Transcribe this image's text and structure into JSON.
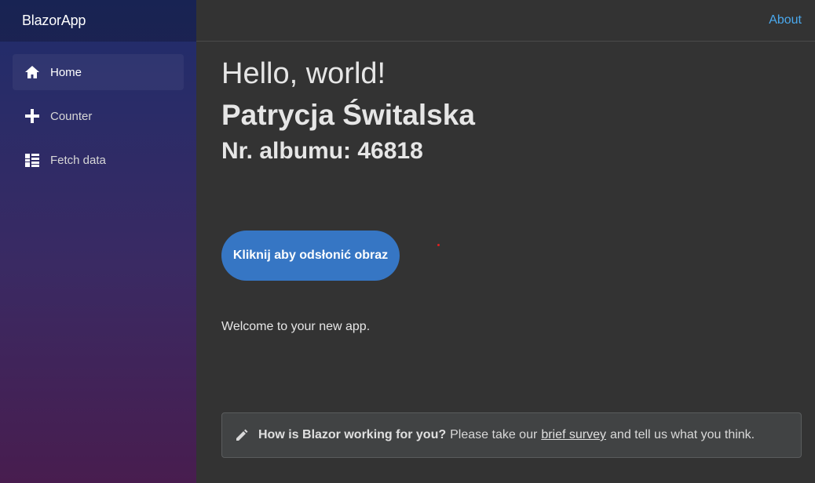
{
  "brand": "BlazorApp",
  "top_row": {
    "about": "About"
  },
  "nav": [
    {
      "label": "Home",
      "icon": "home-icon"
    },
    {
      "label": "Counter",
      "icon": "plus-icon"
    },
    {
      "label": "Fetch data",
      "icon": "list-icon"
    }
  ],
  "main": {
    "hello": "Hello, world!",
    "name": "Patrycja Świtalska",
    "album": "Nr. albumu: 46818",
    "button": "Kliknij aby odsłonić obraz",
    "welcome": "Welcome to your new app."
  },
  "survey": {
    "icon": "pencil-icon",
    "question": "How is Blazor working for you?",
    "pre": "Please take our",
    "link": "brief survey",
    "post": "and tell us what you think."
  },
  "colors": {
    "accent": "#3676c4",
    "link": "#4aa9ee"
  }
}
